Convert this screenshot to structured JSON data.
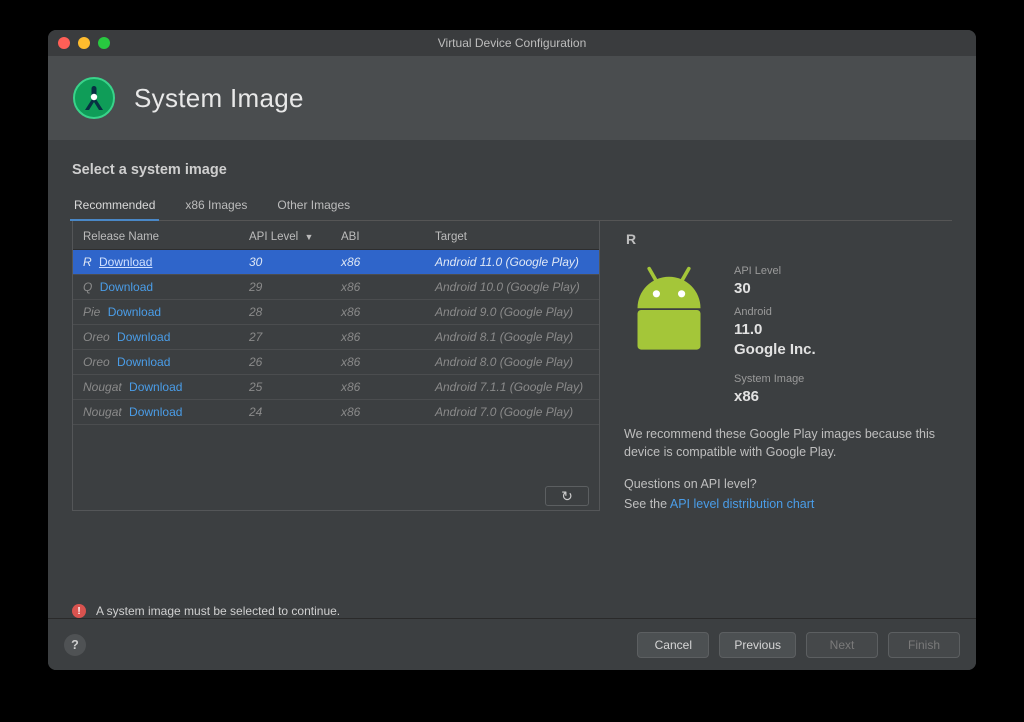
{
  "window": {
    "title": "Virtual Device Configuration",
    "page_title": "System Image",
    "subheading": "Select a system image"
  },
  "tabs": [
    {
      "label": "Recommended",
      "active": true
    },
    {
      "label": "x86 Images",
      "active": false
    },
    {
      "label": "Other Images",
      "active": false
    }
  ],
  "table": {
    "columns": {
      "release_name": "Release Name",
      "api_level": "API Level",
      "abi": "ABI",
      "target": "Target"
    },
    "download_label": "Download",
    "rows": [
      {
        "name": "R",
        "api": "30",
        "abi": "x86",
        "target": "Android 11.0 (Google Play)",
        "selected": true
      },
      {
        "name": "Q",
        "api": "29",
        "abi": "x86",
        "target": "Android 10.0 (Google Play)",
        "selected": false
      },
      {
        "name": "Pie",
        "api": "28",
        "abi": "x86",
        "target": "Android 9.0 (Google Play)",
        "selected": false
      },
      {
        "name": "Oreo",
        "api": "27",
        "abi": "x86",
        "target": "Android 8.1 (Google Play)",
        "selected": false
      },
      {
        "name": "Oreo",
        "api": "26",
        "abi": "x86",
        "target": "Android 8.0 (Google Play)",
        "selected": false
      },
      {
        "name": "Nougat",
        "api": "25",
        "abi": "x86",
        "target": "Android 7.1.1 (Google Play)",
        "selected": false
      },
      {
        "name": "Nougat",
        "api": "24",
        "abi": "x86",
        "target": "Android 7.0 (Google Play)",
        "selected": false
      }
    ]
  },
  "details": {
    "heading": "R",
    "api_level_label": "API Level",
    "api_level_value": "30",
    "android_label": "Android",
    "android_version": "11.0",
    "vendor": "Google Inc.",
    "system_image_label": "System Image",
    "system_image_value": "x86",
    "recommend_text": "We recommend these Google Play images because this device is compatible with Google Play.",
    "question_text": "Questions on API level?",
    "see_prefix": "See the ",
    "chart_link_text": "API level distribution chart"
  },
  "warning_text": "A system image must be selected to continue.",
  "footer": {
    "cancel": "Cancel",
    "previous": "Previous",
    "next": "Next",
    "finish": "Finish"
  }
}
